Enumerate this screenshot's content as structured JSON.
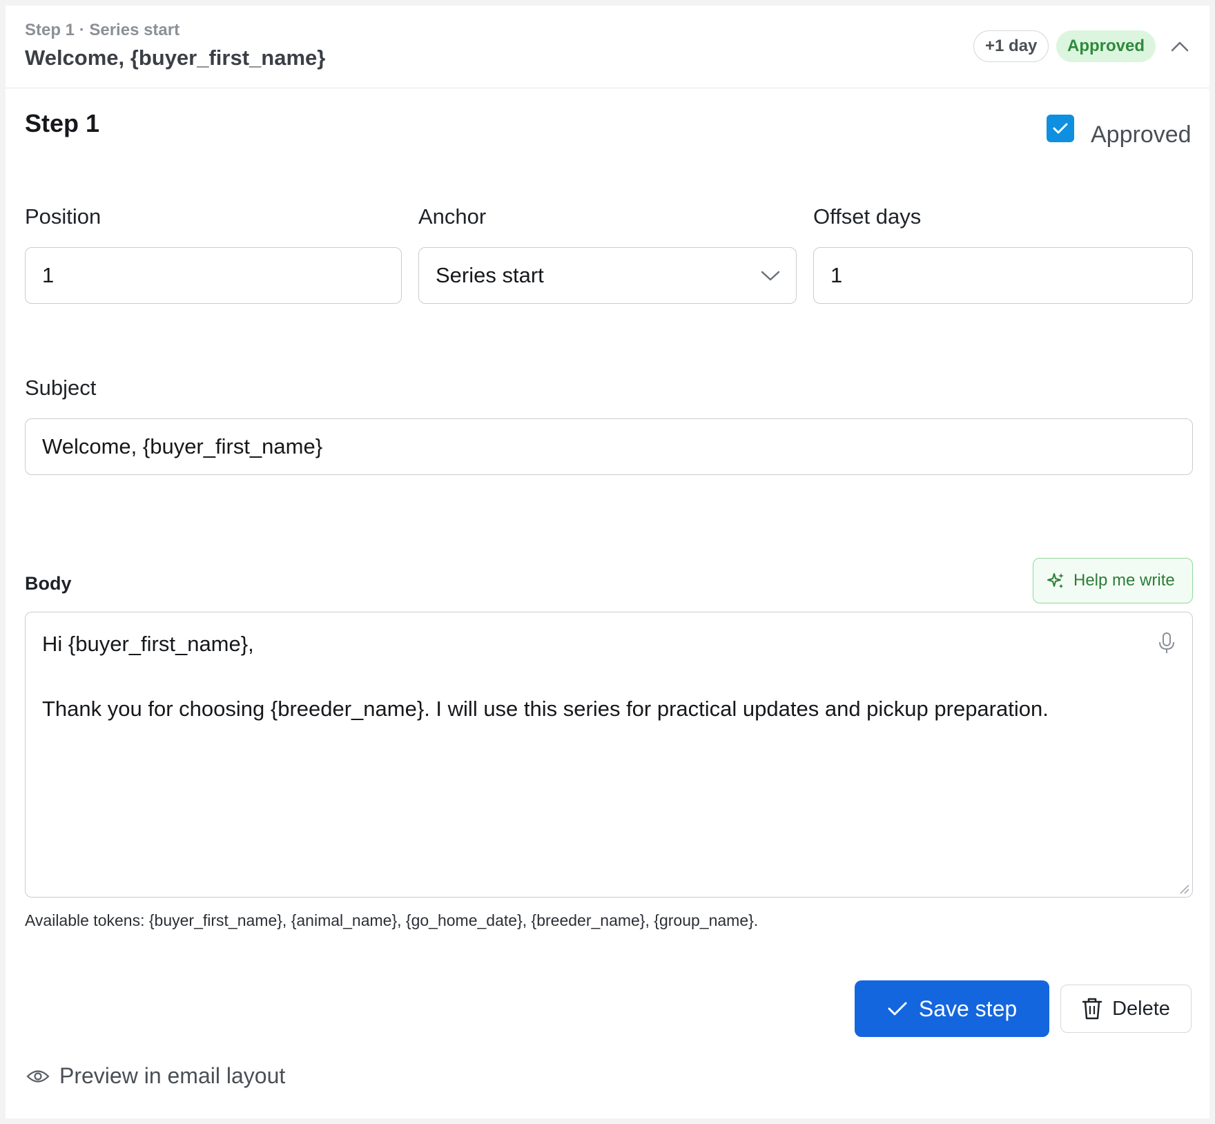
{
  "header": {
    "eyebrow": "Step 1 · Series start",
    "title": "Welcome, {buyer_first_name}",
    "offset_pill": "+1 day",
    "status_pill": "Approved"
  },
  "step": {
    "title": "Step 1",
    "approved_label": "Approved",
    "approved_checked": true
  },
  "fields": {
    "position": {
      "label": "Position",
      "value": "1"
    },
    "anchor": {
      "label": "Anchor",
      "value": "Series start"
    },
    "offset_days": {
      "label": "Offset days",
      "value": "1"
    },
    "subject": {
      "label": "Subject",
      "value": "Welcome, {buyer_first_name}"
    },
    "body": {
      "label": "Body",
      "line1": "Hi {buyer_first_name},",
      "line2": "",
      "line3": "Thank you for choosing {breeder_name}. I will use this series for practical updates and pickup preparation."
    }
  },
  "help_button": "Help me write",
  "tokens_text": "Available tokens: {buyer_first_name}, {animal_name}, {go_home_date}, {breeder_name}, {group_name}.",
  "actions": {
    "save": "Save step",
    "delete": "Delete"
  },
  "preview_link": "Preview in email layout",
  "colors": {
    "primary": "#1466de",
    "checkbox": "#0f8fe0",
    "approved_bg": "#dcf5df",
    "approved_text": "#2f8a3c"
  }
}
